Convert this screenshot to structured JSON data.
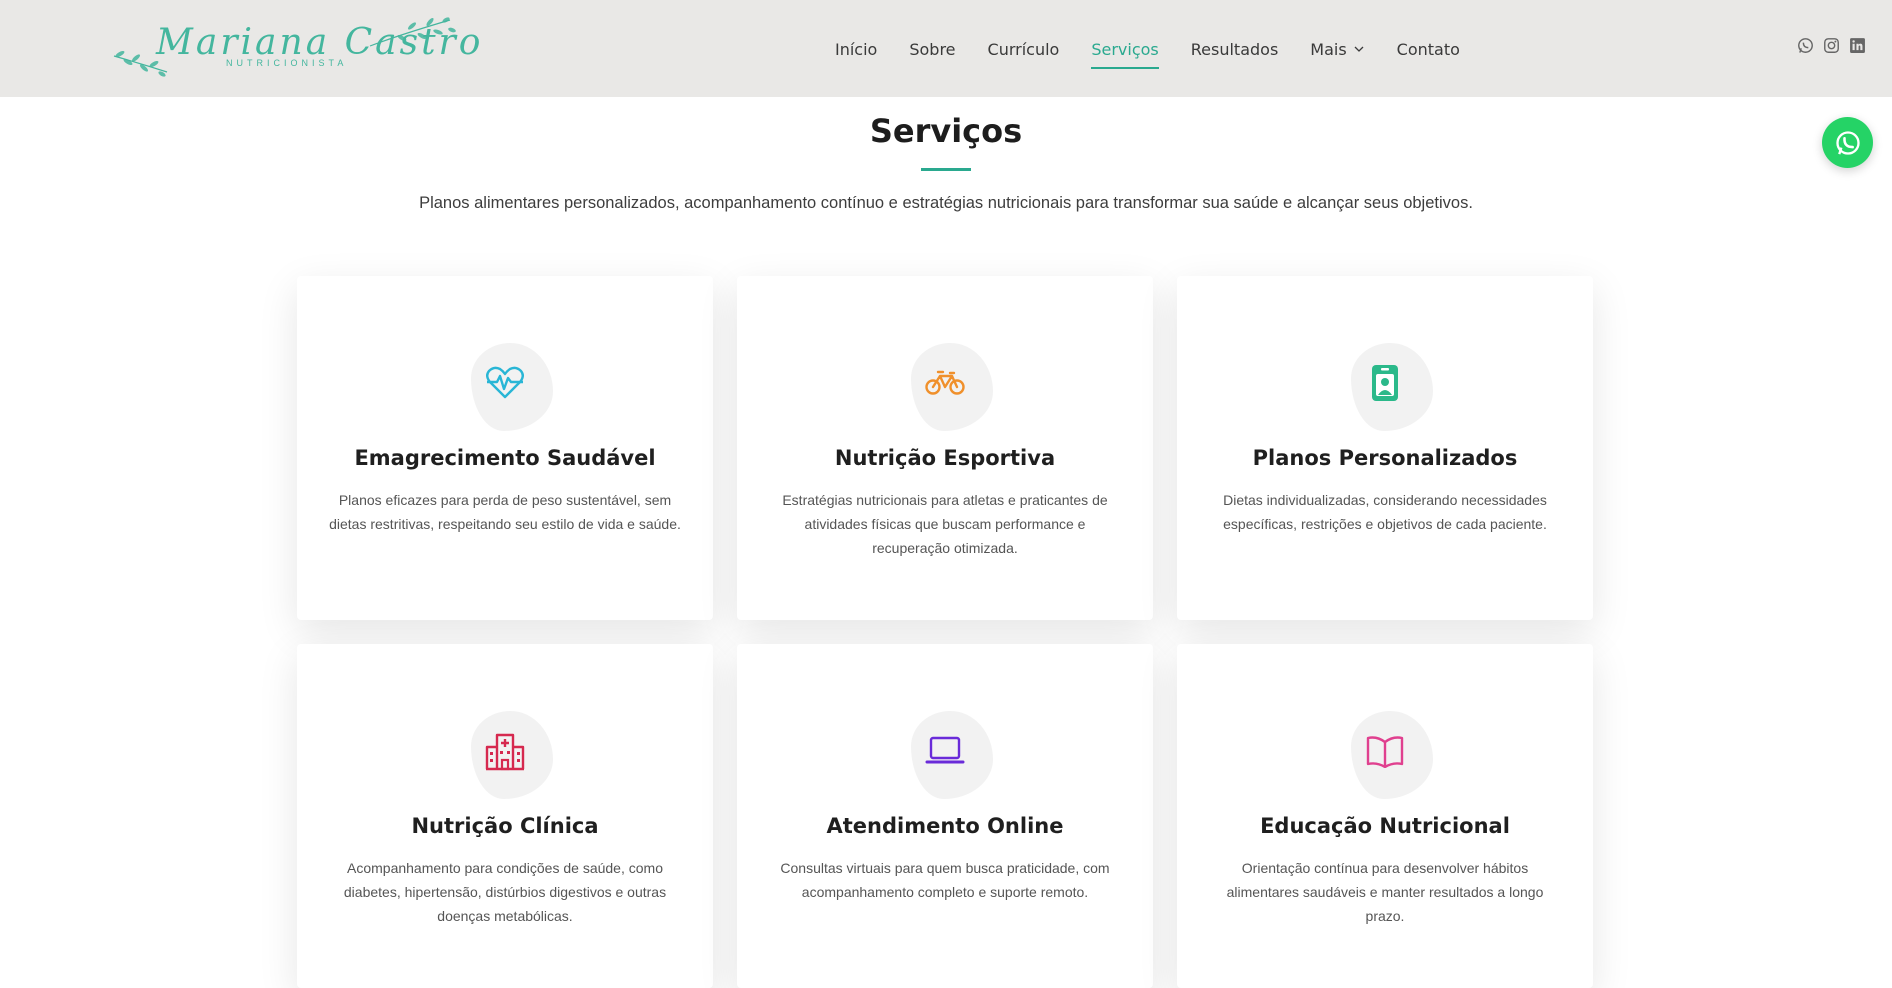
{
  "brand": {
    "name": "Mariana Castro",
    "subtitle": "NUTRICIONISTA",
    "color": "#44b69e"
  },
  "nav": {
    "items": [
      {
        "label": "Início"
      },
      {
        "label": "Sobre"
      },
      {
        "label": "Currículo"
      },
      {
        "label": "Serviços",
        "active": true
      },
      {
        "label": "Resultados"
      },
      {
        "label": "Mais"
      },
      {
        "label": "Contato"
      }
    ]
  },
  "social": [
    "whatsapp-icon",
    "instagram-icon",
    "linkedin-icon"
  ],
  "section": {
    "title": "Serviços",
    "description": "Planos alimentares personalizados, acompanhamento contínuo e estratégias nutricionais para transformar sua saúde e alcançar seus objetivos."
  },
  "cards": [
    {
      "title": "Emagrecimento Saudável",
      "icon": "heart-pulse-icon",
      "color": "#29b6d6",
      "description": "Planos eficazes para perda de peso sustentável, sem dietas restritivas, respeitando seu estilo de vida e saúde."
    },
    {
      "title": "Nutrição Esportiva",
      "icon": "bicycle-icon",
      "color": "#f0902b",
      "description": "Estratégias nutricionais para atletas e praticantes de atividades físicas que buscam performance e recuperação otimizada."
    },
    {
      "title": "Planos Personalizados",
      "icon": "badge-user-icon",
      "color": "#2bb98a",
      "description": "Dietas individualizadas, considerando necessidades específicas, restrições e objetivos de cada paciente."
    },
    {
      "title": "Nutrição Clínica",
      "icon": "hospital-icon",
      "color": "#d6294f",
      "description": "Acompanhamento para condições de saúde, como diabetes, hipertensão, distúrbios digestivos e outras doenças metabólicas."
    },
    {
      "title": "Atendimento Online",
      "icon": "laptop-icon",
      "color": "#6a2bd9",
      "description": "Consultas virtuais para quem busca praticidade, com acompanhamento completo e suporte remoto."
    },
    {
      "title": "Educação Nutricional",
      "icon": "book-open-icon",
      "color": "#e0408f",
      "description": "Orientação contínua para desenvolver hábitos alimentares saudáveis e manter resultados a longo prazo."
    }
  ],
  "colors": {
    "accent": "#2aa98f",
    "header_bg": "#e9e8e6",
    "whatsapp": "#25d366"
  }
}
